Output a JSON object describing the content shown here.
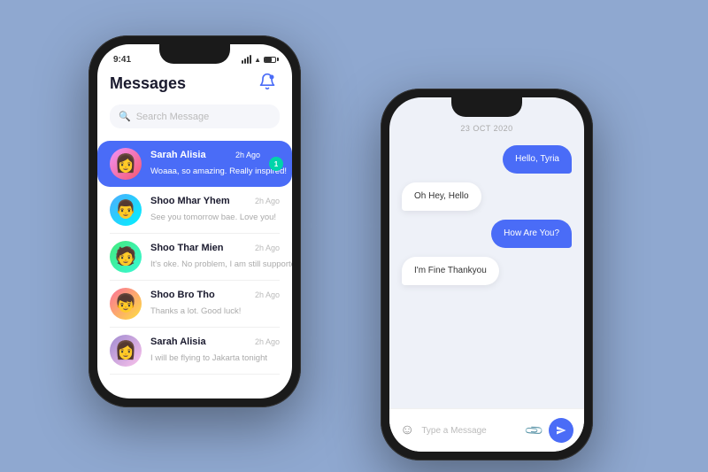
{
  "background": "#8fa8d0",
  "leftPhone": {
    "statusBar": {
      "time": "9:41"
    },
    "header": {
      "title": "Messages",
      "bellLabel": "🔔"
    },
    "search": {
      "placeholder": "Search Message"
    },
    "chatList": [
      {
        "id": 1,
        "name": "Sarah Alisia",
        "preview": "Woaaa, so amazing. Really inspired!",
        "time": "2h Ago",
        "active": true,
        "unread": "1",
        "avatarClass": "avatar-1",
        "avatarEmoji": "👩"
      },
      {
        "id": 2,
        "name": "Shoo Mhar Yhem",
        "preview": "See you tomorrow bae. Love you!",
        "time": "2h Ago",
        "active": false,
        "avatarClass": "avatar-2",
        "avatarEmoji": "👨"
      },
      {
        "id": 3,
        "name": "Shoo Thar Mien",
        "preview": "It's oke. No problem, I am still supported you",
        "time": "2h Ago",
        "active": false,
        "avatarClass": "avatar-3",
        "avatarEmoji": "🧑"
      },
      {
        "id": 4,
        "name": "Shoo Bro Tho",
        "preview": "Thanks a lot. Good luck!",
        "time": "2h Ago",
        "active": false,
        "avatarClass": "avatar-4",
        "avatarEmoji": "👦"
      },
      {
        "id": 5,
        "name": "Sarah Alisia",
        "preview": "I will be flying to Jakarta tonight",
        "time": "2h Ago",
        "active": false,
        "avatarClass": "avatar-5",
        "avatarEmoji": "👩"
      }
    ]
  },
  "rightPhone": {
    "dateHeader": "23 OCT 2020",
    "messages": [
      {
        "id": 1,
        "text": "Hello, Tyria",
        "type": "sent"
      },
      {
        "id": 2,
        "text": "Oh Hey, Hello",
        "type": "received"
      },
      {
        "id": 3,
        "text": "How Are You?",
        "type": "sent"
      },
      {
        "id": 4,
        "text": "I'm Fine Thankyou",
        "type": "received"
      }
    ],
    "inputPlaceholder": "Type a Message",
    "emojiIcon": "☺",
    "attachIcon": "📎",
    "sendLabel": "➤"
  }
}
